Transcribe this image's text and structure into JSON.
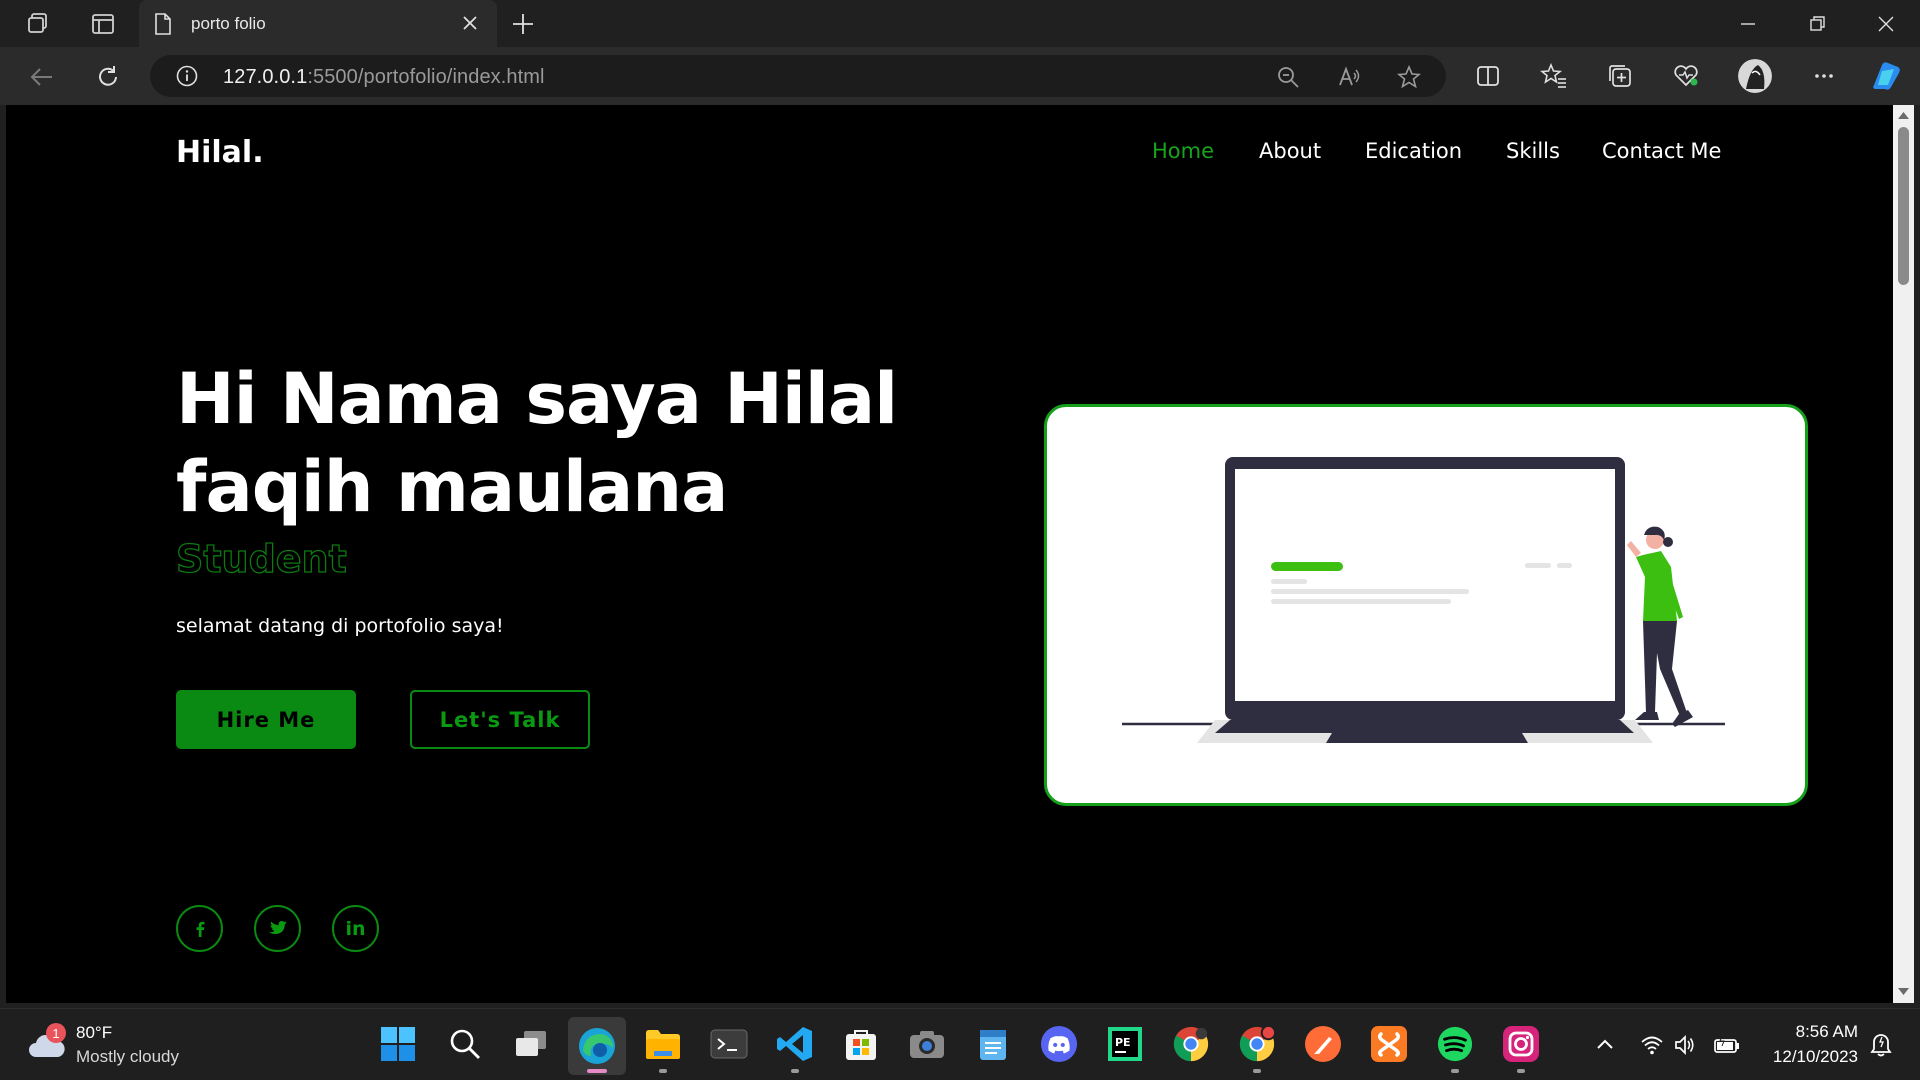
{
  "browser": {
    "tab_title": "porto folio",
    "url_host": "127.0.0.1",
    "url_path": ":5500/portofolio/index.html"
  },
  "page": {
    "logo": "Hilal.",
    "nav": [
      "Home",
      "About",
      "Edication",
      "Skills",
      "Contact Me"
    ],
    "hero_title_line1": "Hi Nama saya Hilal",
    "hero_title_line2": "faqih maulana",
    "hero_role": "Student",
    "hero_sub": "selamat datang di portofolio saya!",
    "hire_label": "Hire Me",
    "talk_label": "Let's Talk",
    "social": [
      "facebook-icon",
      "twitter-icon",
      "linkedin-icon"
    ],
    "social_linkedin_text": "in",
    "accent_color": "#0a8a12"
  },
  "taskbar": {
    "weather_badge": "1",
    "weather_temp": "80°F",
    "weather_desc": "Mostly cloudy",
    "time": "8:56 AM",
    "date": "12/10/2023",
    "apps": [
      "start-icon",
      "search-icon",
      "task-view-icon",
      "edge-icon",
      "file-explorer-icon",
      "terminal-icon",
      "vscode-icon",
      "store-icon",
      "camera-icon",
      "notepad-icon",
      "discord-icon",
      "pycharm-icon",
      "chrome-icon",
      "chrome-profile-icon",
      "tool-icon",
      "xampp-icon",
      "spotify-icon",
      "instagram-icon"
    ]
  }
}
